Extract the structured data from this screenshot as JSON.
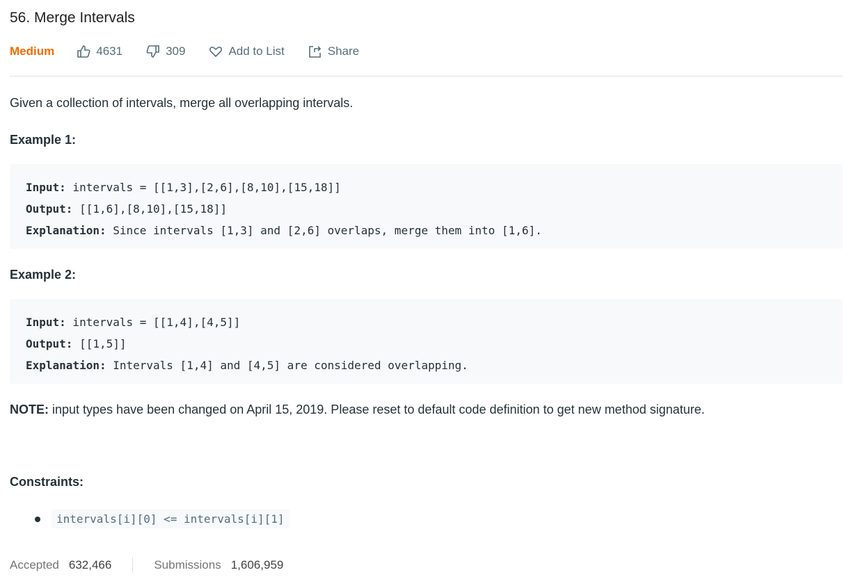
{
  "title": "56. Merge Intervals",
  "difficulty": "Medium",
  "likes": "4631",
  "dislikes": "309",
  "add_to_list": "Add to List",
  "share": "Share",
  "description": "Given a collection of intervals, merge all overlapping intervals.",
  "examples": [
    {
      "heading": "Example 1:",
      "input_label": "Input:",
      "input": " intervals = [[1,3],[2,6],[8,10],[15,18]]",
      "output_label": "Output:",
      "output": " [[1,6],[8,10],[15,18]]",
      "explanation_label": "Explanation:",
      "explanation": " Since intervals [1,3] and [2,6] overlaps, merge them into [1,6]."
    },
    {
      "heading": "Example 2:",
      "input_label": "Input:",
      "input": " intervals = [[1,4],[4,5]]",
      "output_label": "Output:",
      "output": " [[1,5]]",
      "explanation_label": "Explanation:",
      "explanation": " Intervals [1,4] and [4,5] are considered overlapping."
    }
  ],
  "note_label": "NOTE:",
  "note": " input types have been changed on April 15, 2019. Please reset to default code definition to get new method signature.",
  "constraints_heading": "Constraints:",
  "constraints": [
    "intervals[i][0] <= intervals[i][1]"
  ],
  "stats": {
    "accepted_label": "Accepted",
    "accepted": "632,466",
    "submissions_label": "Submissions",
    "submissions": "1,606,959"
  }
}
